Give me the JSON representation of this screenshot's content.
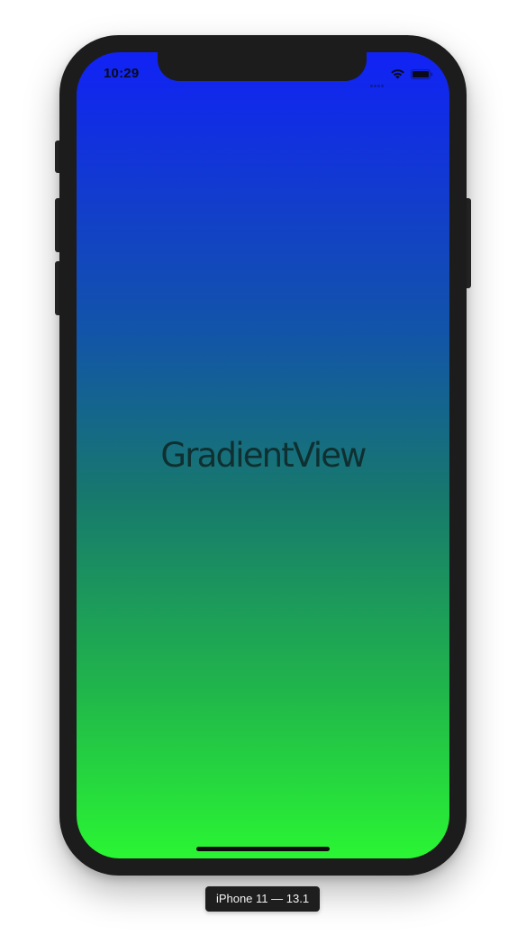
{
  "status_bar": {
    "time": "10:29",
    "signal_icon": "cellular-signal-icon",
    "wifi_icon": "wifi-icon",
    "battery_icon": "battery-icon"
  },
  "app": {
    "title": "GradientView",
    "gradient_colors": [
      "#1122f5",
      "#1255a8",
      "#17786d",
      "#21b84a",
      "#2af533"
    ]
  },
  "device": {
    "label": "iPhone 11 — 13.1",
    "bezel_color": "#1c1c1c"
  }
}
